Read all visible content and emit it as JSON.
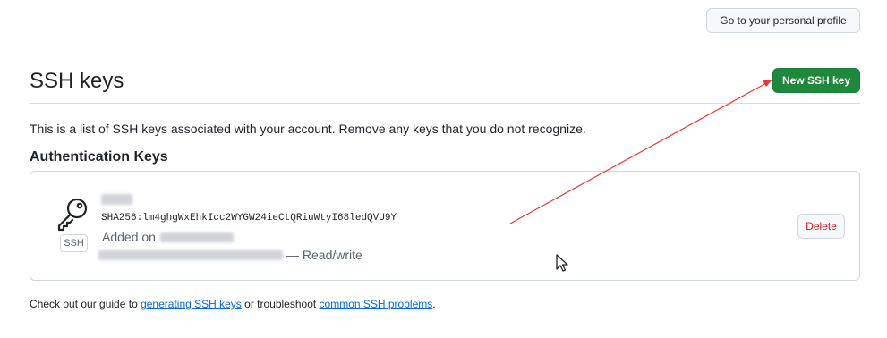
{
  "header": {
    "profile_button": "Go to your personal profile"
  },
  "section": {
    "title": "SSH keys",
    "new_button": "New SSH key",
    "description": "This is a list of SSH keys associated with your account. Remove any keys that you do not recognize.",
    "subheading": "Authentication Keys"
  },
  "key": {
    "icon": "key-icon",
    "type_badge": "SSH",
    "fingerprint": "SHA256:lm4ghgWxEhkIcc2WYGW24ieCtQRiuWtyI68ledQVU9Y",
    "added_prefix": "Added on",
    "access": "— Read/write",
    "delete_label": "Delete"
  },
  "footer": {
    "prefix": "Check out our guide to ",
    "link_generating": "generating SSH keys",
    "middle": " or troubleshoot ",
    "link_problems": "common SSH problems",
    "suffix": "."
  },
  "colors": {
    "primary_button": "#1f883d",
    "danger_text": "#cf222e",
    "link": "#0969da",
    "border": "#d0d7de",
    "annotation_arrow": "#e53935"
  }
}
